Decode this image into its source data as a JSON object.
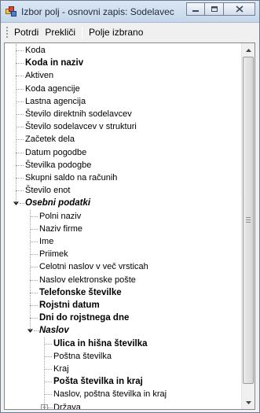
{
  "window": {
    "title": "Izbor polj - osnovni zapis: Sodelavec"
  },
  "toolbar": {
    "confirm_label": "Potrdi",
    "cancel_label": "Prekliči",
    "empty_field_label": "Polje izbrano"
  },
  "tree": {
    "items": [
      {
        "label": "Koda"
      },
      {
        "label": "Koda in naziv"
      },
      {
        "label": "Aktiven"
      },
      {
        "label": "Koda agencije"
      },
      {
        "label": "Lastna agencija"
      },
      {
        "label": "Število direktnih sodelavcev"
      },
      {
        "label": "Število sodelavcev v strukturi"
      },
      {
        "label": "Začetek dela"
      },
      {
        "label": "Datum pogodbe"
      },
      {
        "label": "Številka podogbe"
      },
      {
        "label": "Skupni saldo na računih"
      },
      {
        "label": "Število enot"
      },
      {
        "label": "Osebni podatki"
      },
      {
        "label": "Polni naziv"
      },
      {
        "label": "Naziv firme"
      },
      {
        "label": "Ime"
      },
      {
        "label": "Priimek"
      },
      {
        "label": "Celotni naslov v več vrsticah"
      },
      {
        "label": "Naslov elektronske pošte"
      },
      {
        "label": "Telefonske številke"
      },
      {
        "label": "Rojstni datum"
      },
      {
        "label": "Dni do rojstnega dne"
      },
      {
        "label": "Naslov"
      },
      {
        "label": "Ulica in hišna številka"
      },
      {
        "label": "Poštna številka"
      },
      {
        "label": "Kraj"
      },
      {
        "label": "Pošta številka in kraj"
      },
      {
        "label": "Naslov, poštna številka in kraj"
      },
      {
        "label": "Država"
      }
    ]
  },
  "icons": {
    "app": "app-icon",
    "minimize": "minimize-icon",
    "maximize": "maximize-icon",
    "close": "close-icon",
    "collapse": "collapse-icon",
    "expand": "expand-icon",
    "scroll_up": "scroll-up-icon",
    "scroll_down": "scroll-down-icon"
  }
}
